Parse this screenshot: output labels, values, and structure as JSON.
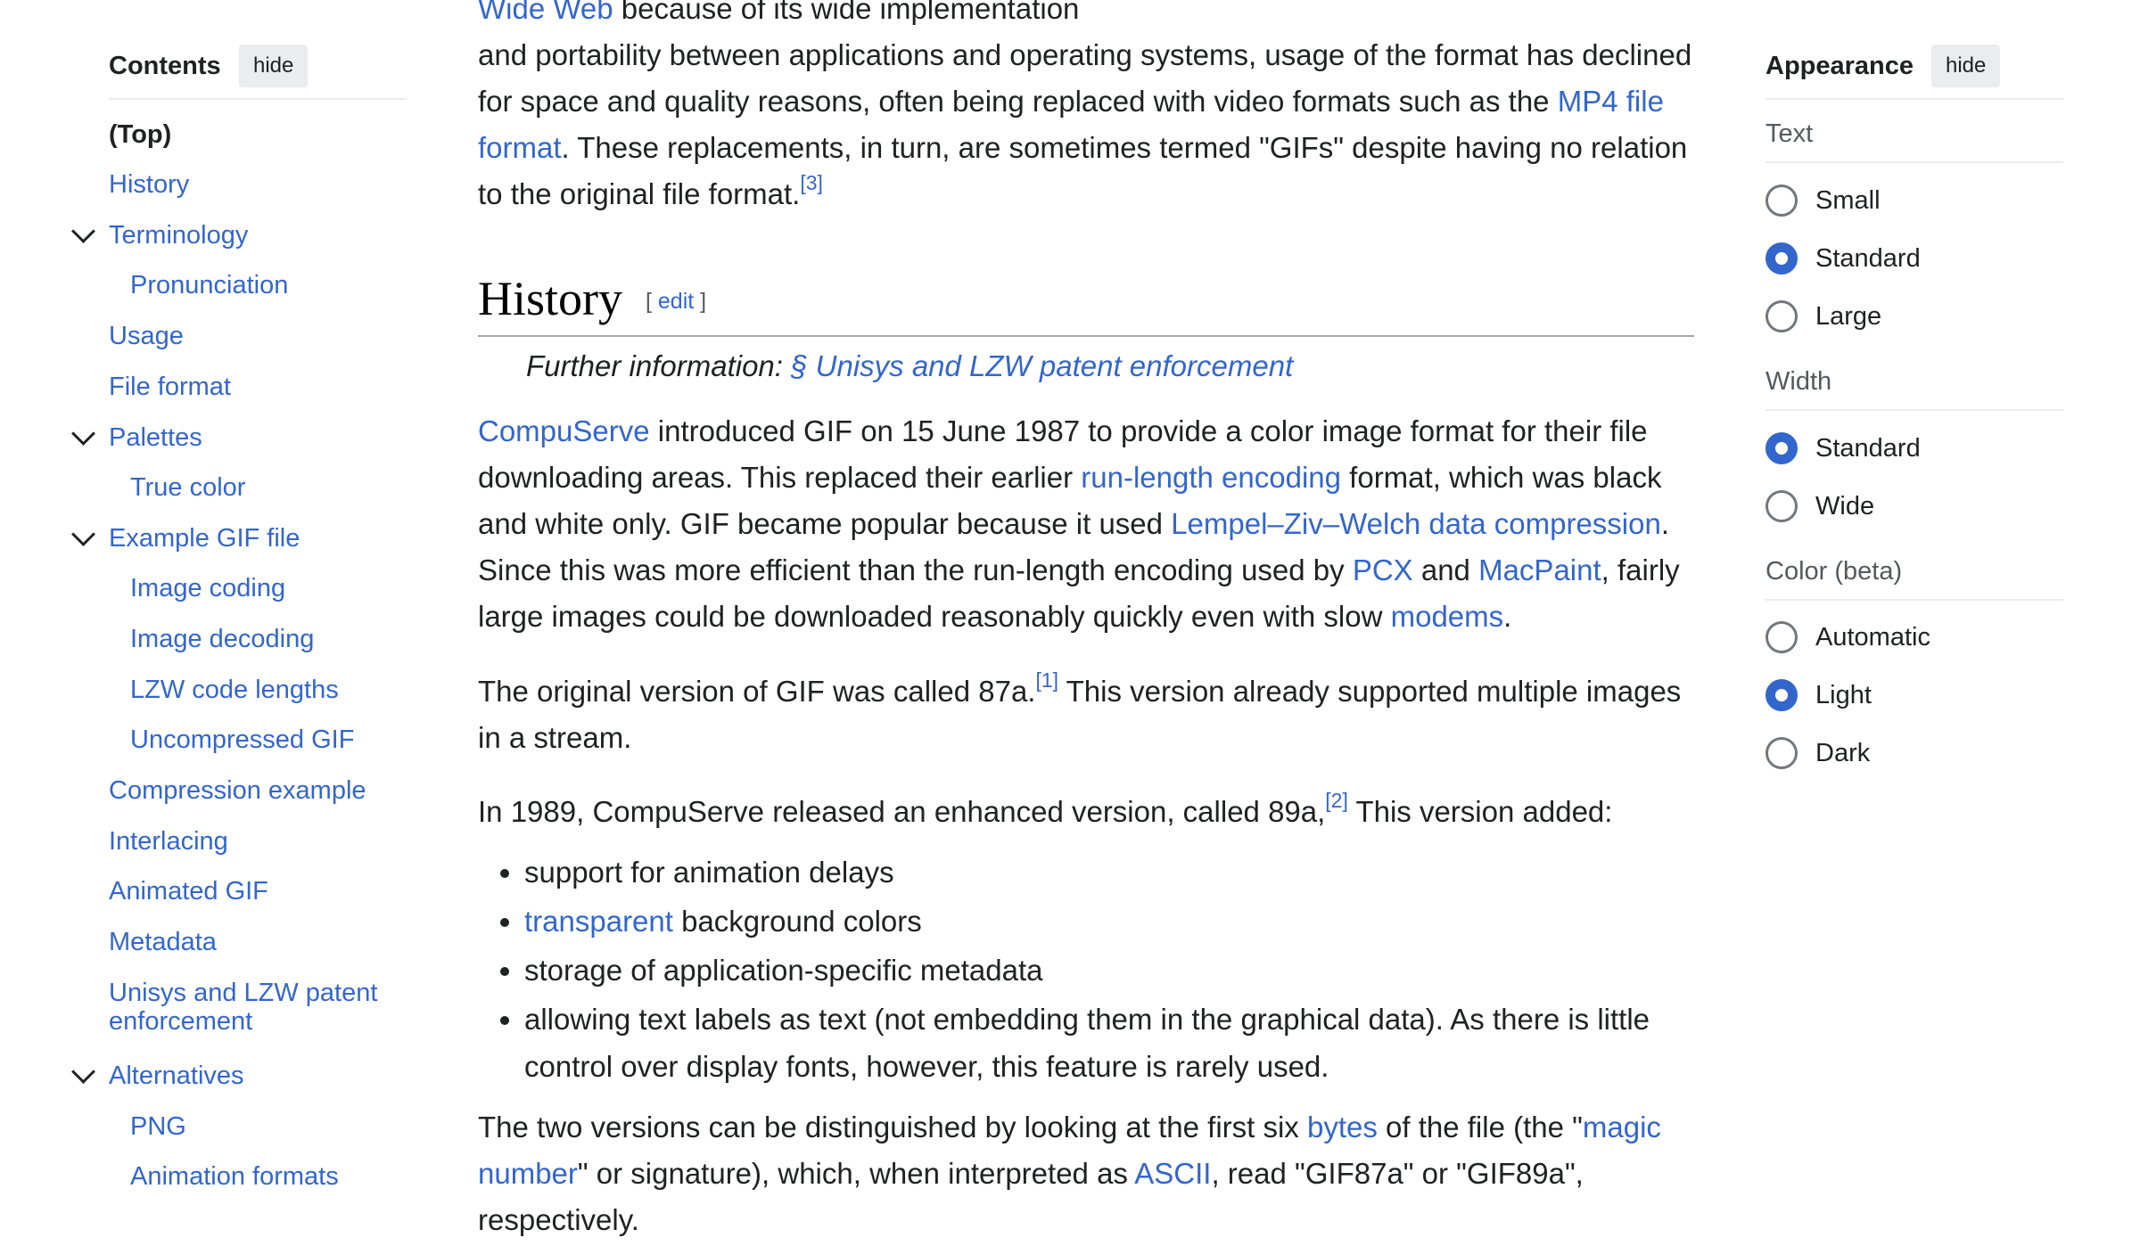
{
  "toc": {
    "title": "Contents",
    "hide_label": "hide",
    "items": [
      {
        "label": "(Top)"
      },
      {
        "label": "History"
      },
      {
        "label": "Terminology"
      },
      {
        "label": "Pronunciation"
      },
      {
        "label": "Usage"
      },
      {
        "label": "File format"
      },
      {
        "label": "Palettes"
      },
      {
        "label": "True color"
      },
      {
        "label": "Example GIF file"
      },
      {
        "label": "Image coding"
      },
      {
        "label": "Image decoding"
      },
      {
        "label": "LZW code lengths"
      },
      {
        "label": "Uncompressed GIF"
      },
      {
        "label": "Compression example"
      },
      {
        "label": "Interlacing"
      },
      {
        "label": "Animated GIF"
      },
      {
        "label": "Metadata"
      },
      {
        "label": "Unisys and LZW patent"
      },
      {
        "label": "enforcement"
      },
      {
        "label": "Alternatives"
      },
      {
        "label": "PNG"
      },
      {
        "label": "Animation formats"
      }
    ]
  },
  "article": {
    "intro": {
      "link_wide_web": "Wide Web",
      "t1": " because of its wide implementation",
      "t2": "and portability between applications and operating systems, usage of the format has declined for space and quality reasons, often being replaced with video formats such as the ",
      "link_mp4": "MP4 file format",
      "t3": ". These replacements, in turn, are sometimes termed \"GIFs\" despite having no relation to the original file format.",
      "ref3": "[3]"
    },
    "history_heading": "History",
    "edit_label": "edit",
    "hatnote_prefix": "Further information: ",
    "hatnote_link": "§ Unisys and LZW patent enforcement",
    "p1": {
      "link_compuserve": "CompuServe",
      "t1": " introduced GIF on 15 June 1987 to provide a color image format for their file downloading areas. This replaced their earlier ",
      "link_rle": "run-length encoding",
      "t2": " format, which was black and white only. GIF became popular because it used ",
      "link_lzw": "Lempel–Ziv–Welch data compression",
      "t3": ". Since this was more efficient than the run-length encoding used by ",
      "link_pcx": "PCX",
      "t4": " and ",
      "link_macpaint": "MacPaint",
      "t5": ", fairly large images could be downloaded reasonably quickly even with slow ",
      "link_modems": "modems",
      "t6": "."
    },
    "p2": {
      "t1": "The original version of GIF was called 87a.",
      "ref1": "[1]",
      "t2": " This version already supported multiple images in a stream."
    },
    "p3": {
      "t1": "In 1989, CompuServe released an enhanced version, called 89a,",
      "ref2": "[2]",
      "t2": " This version added:"
    },
    "bullets": {
      "b1": "support for animation delays",
      "b2_link": "transparent",
      "b2_text": " background colors",
      "b3": "storage of application-specific metadata",
      "b4": "allowing text labels as text (not embedding them in the graphical data). As there is little control over display fonts, however, this feature is rarely used."
    },
    "p4": {
      "t1": "The two versions can be distinguished by looking at the first six ",
      "link_bytes": "bytes",
      "t2": " of the file (the \"",
      "link_magic": "magic number",
      "t3": "\" or signature), which, when interpreted as ",
      "link_ascii": "ASCII",
      "t4": ", read \"GIF87a\" or \"GIF89a\", respectively."
    }
  },
  "appearance": {
    "title": "Appearance",
    "hide_label": "hide",
    "text_label": "Text",
    "text_options": [
      "Small",
      "Standard",
      "Large"
    ],
    "text_selected": "Standard",
    "width_label": "Width",
    "width_options": [
      "Standard",
      "Wide"
    ],
    "width_selected": "Standard",
    "color_label": "Color (beta)",
    "color_options": [
      "Automatic",
      "Light",
      "Dark"
    ],
    "color_selected": "Light"
  },
  "colors": {
    "link": "#3366cc",
    "text": "#202122",
    "muted": "#54595d",
    "button_bg": "#eaecf0"
  }
}
